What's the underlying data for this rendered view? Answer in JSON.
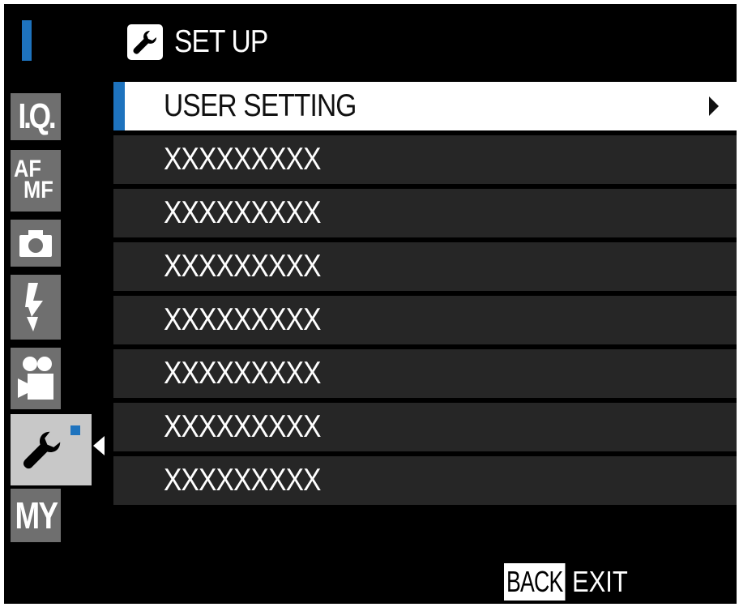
{
  "header": {
    "title": "SET UP",
    "icon": "wrench-icon"
  },
  "sidebar": {
    "tabs": [
      {
        "label": "I.Q.",
        "icon": "image-quality-icon"
      },
      {
        "label_top": "AF",
        "label_bottom": "MF",
        "icon": "af-mf-icon"
      },
      {
        "label": "",
        "icon": "camera-icon"
      },
      {
        "label": "",
        "icon": "flash-icon"
      },
      {
        "label": "",
        "icon": "movie-camera-icon"
      },
      {
        "label": "",
        "icon": "wrench-icon",
        "selected": true
      },
      {
        "label": "MY",
        "icon": "my-menu-icon"
      }
    ]
  },
  "menu": {
    "items": [
      {
        "label": "USER SETTING",
        "highlighted": true,
        "has_submenu": true
      },
      {
        "label": "XXXXXXXXX"
      },
      {
        "label": "XXXXXXXXX"
      },
      {
        "label": "XXXXXXXXX"
      },
      {
        "label": "XXXXXXXXX"
      },
      {
        "label": "XXXXXXXXX"
      },
      {
        "label": "XXXXXXXXX"
      },
      {
        "label": "XXXXXXXXX"
      }
    ]
  },
  "footer": {
    "back_label": "BACK",
    "exit_label": "EXIT"
  },
  "colors": {
    "background": "#000000",
    "accent": "#1e73be",
    "row": "#262626",
    "highlight": "#ffffff",
    "tab": "#6f6f6f",
    "tab_selected": "#c8c8c8"
  }
}
